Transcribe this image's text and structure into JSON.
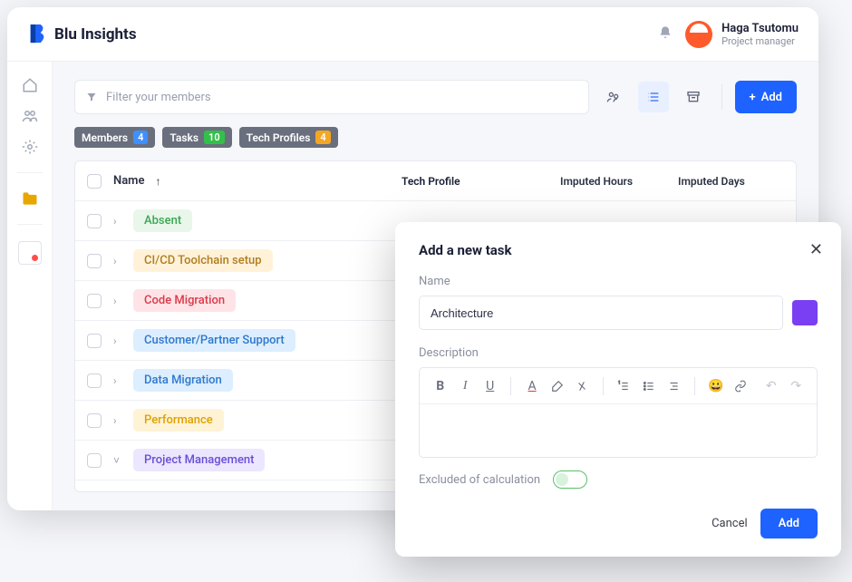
{
  "app": {
    "name": "Blu Insights"
  },
  "user": {
    "name": "Haga Tsutomu",
    "role": "Project manager"
  },
  "toolbar": {
    "filter_placeholder": "Filter your members",
    "add_label": "Add"
  },
  "filter_tags": [
    {
      "label": "Members",
      "count": "4",
      "count_bg": "#3e90ff"
    },
    {
      "label": "Tasks",
      "count": "10",
      "count_bg": "#33c04a"
    },
    {
      "label": "Tech Profiles",
      "count": "4",
      "count_bg": "#f5a623"
    }
  ],
  "columns": {
    "name": "Name",
    "tech": "Tech Profile",
    "hours": "Imputed Hours",
    "days": "Imputed Days"
  },
  "rows": [
    {
      "label": "Absent",
      "bg": "#e9f7ea",
      "fg": "#3aa655",
      "expanded": false
    },
    {
      "label": "CI/CD Toolchain setup",
      "bg": "#fff2d9",
      "fg": "#b07d1e",
      "expanded": false
    },
    {
      "label": "Code Migration",
      "bg": "#ffe3e6",
      "fg": "#d93a4a",
      "expanded": false
    },
    {
      "label": "Customer/Partner Support",
      "bg": "#dceeff",
      "fg": "#2f78cc",
      "expanded": false
    },
    {
      "label": "Data Migration",
      "bg": "#dceeff",
      "fg": "#2f78cc",
      "expanded": false
    },
    {
      "label": "Performance",
      "bg": "#fff3d6",
      "fg": "#dfa100",
      "expanded": false
    },
    {
      "label": "Project Management",
      "bg": "#ece6ff",
      "fg": "#6a4fd6",
      "expanded": true
    }
  ],
  "modal": {
    "title": "Add a new task",
    "name_label": "Name",
    "name_value": "Architecture",
    "description_label": "Description",
    "excluded_label": "Excluded of calculation",
    "cancel": "Cancel",
    "add": "Add",
    "color": "#7a3ff2"
  }
}
